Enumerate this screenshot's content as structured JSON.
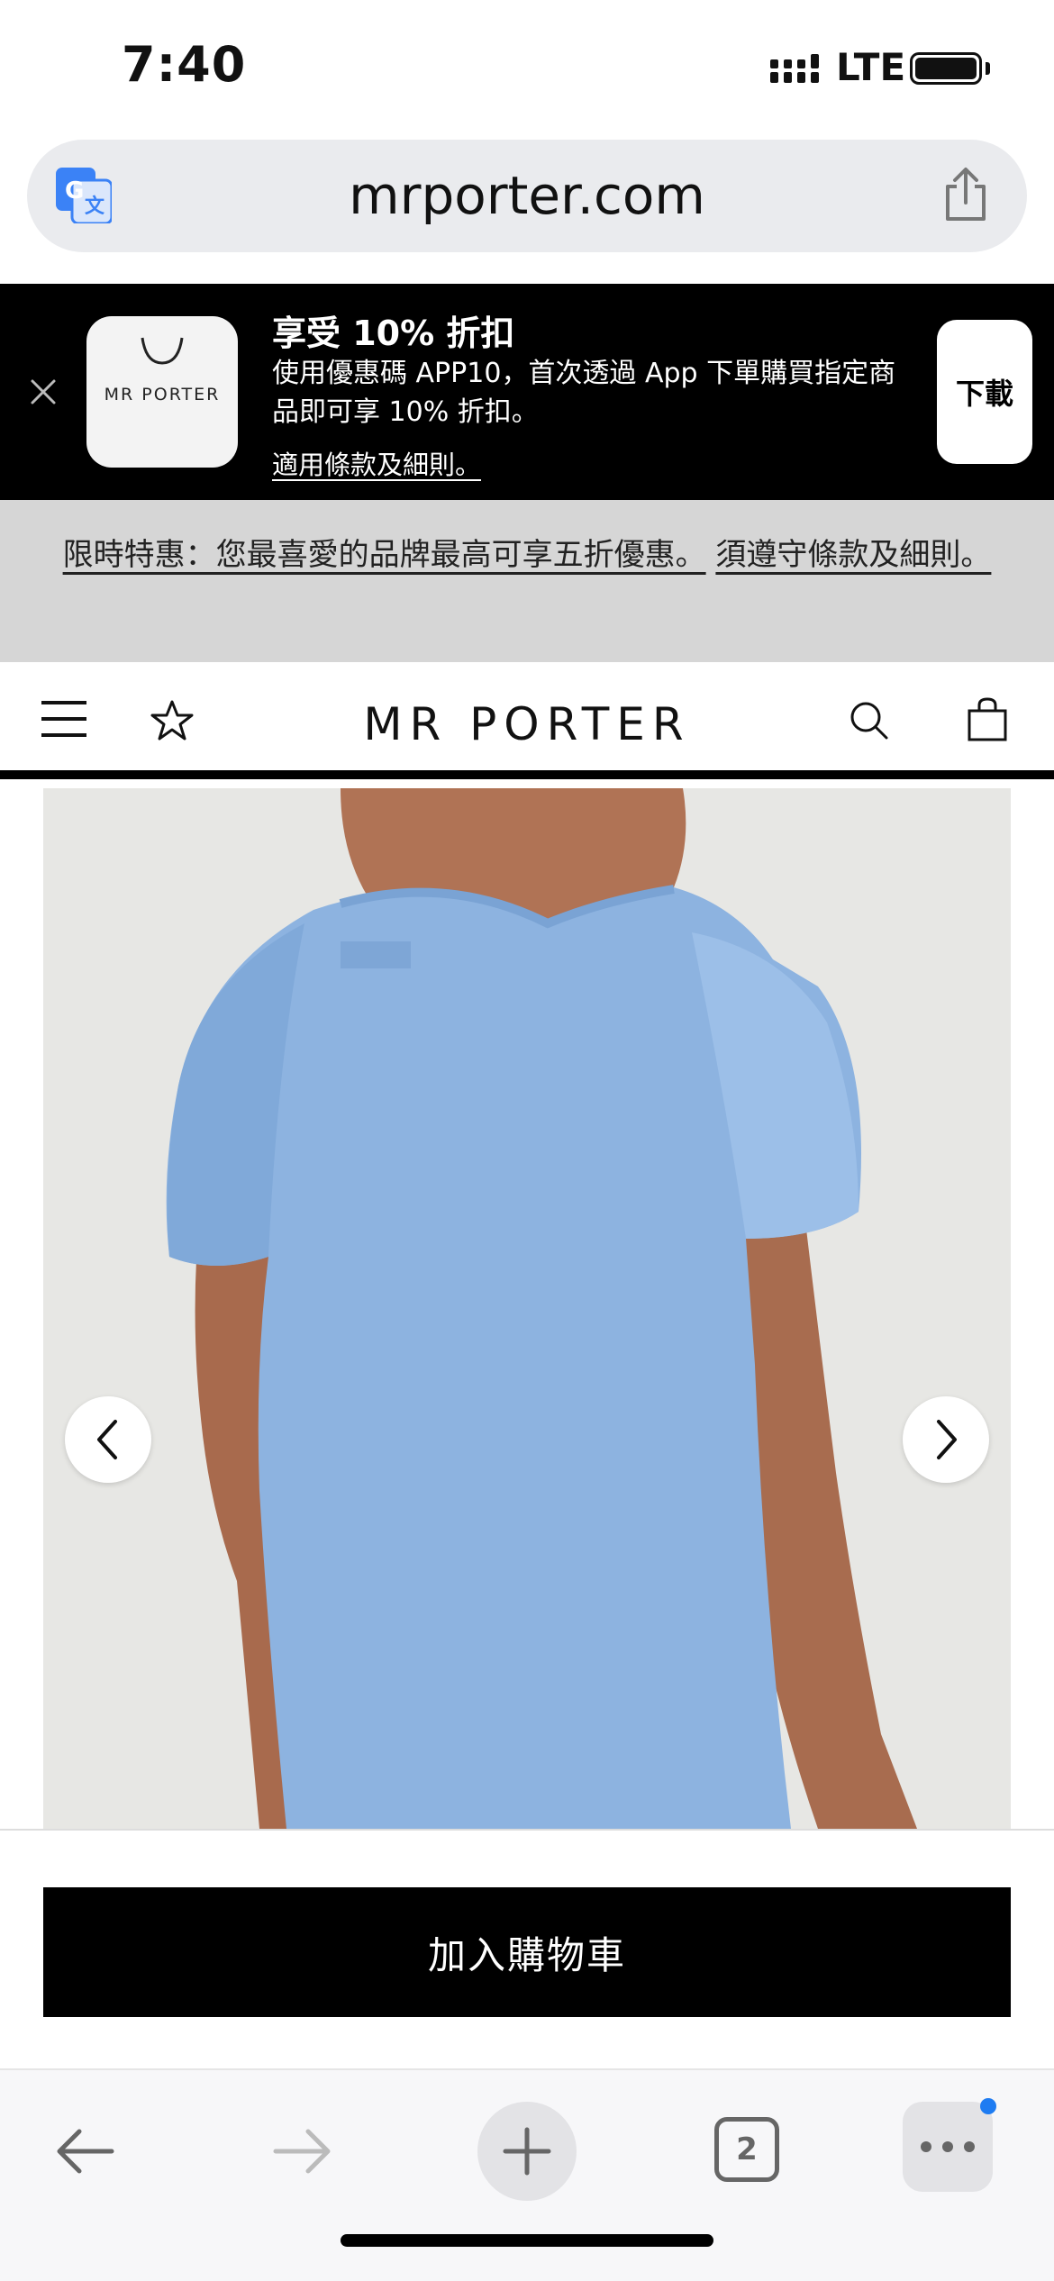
{
  "status_bar": {
    "time": "7:40",
    "network": "LTE"
  },
  "browser": {
    "url": "mrporter.com",
    "open_tabs": "2"
  },
  "app_banner": {
    "app_icon_label": "MR PORTER",
    "title": "享受 10% 折扣",
    "description": "使用優惠碼 APP10，首次透過 App 下單購買指定商品即可享 10% 折扣。",
    "terms_link": "適用條款及細則。",
    "download_label": "下載"
  },
  "promo": {
    "text": "限時特惠：您最喜愛的品牌最高可享五折優惠。",
    "terms_link": "須遵守條款及細則。"
  },
  "header": {
    "logo": "MR PORTER"
  },
  "product": {
    "add_to_cart_label": "加入購物車"
  },
  "colors": {
    "banner_bg": "#000000",
    "promo_bg": "#d6d6d6",
    "shirt": "#8db3e0",
    "notification": "#1e7cf2"
  }
}
